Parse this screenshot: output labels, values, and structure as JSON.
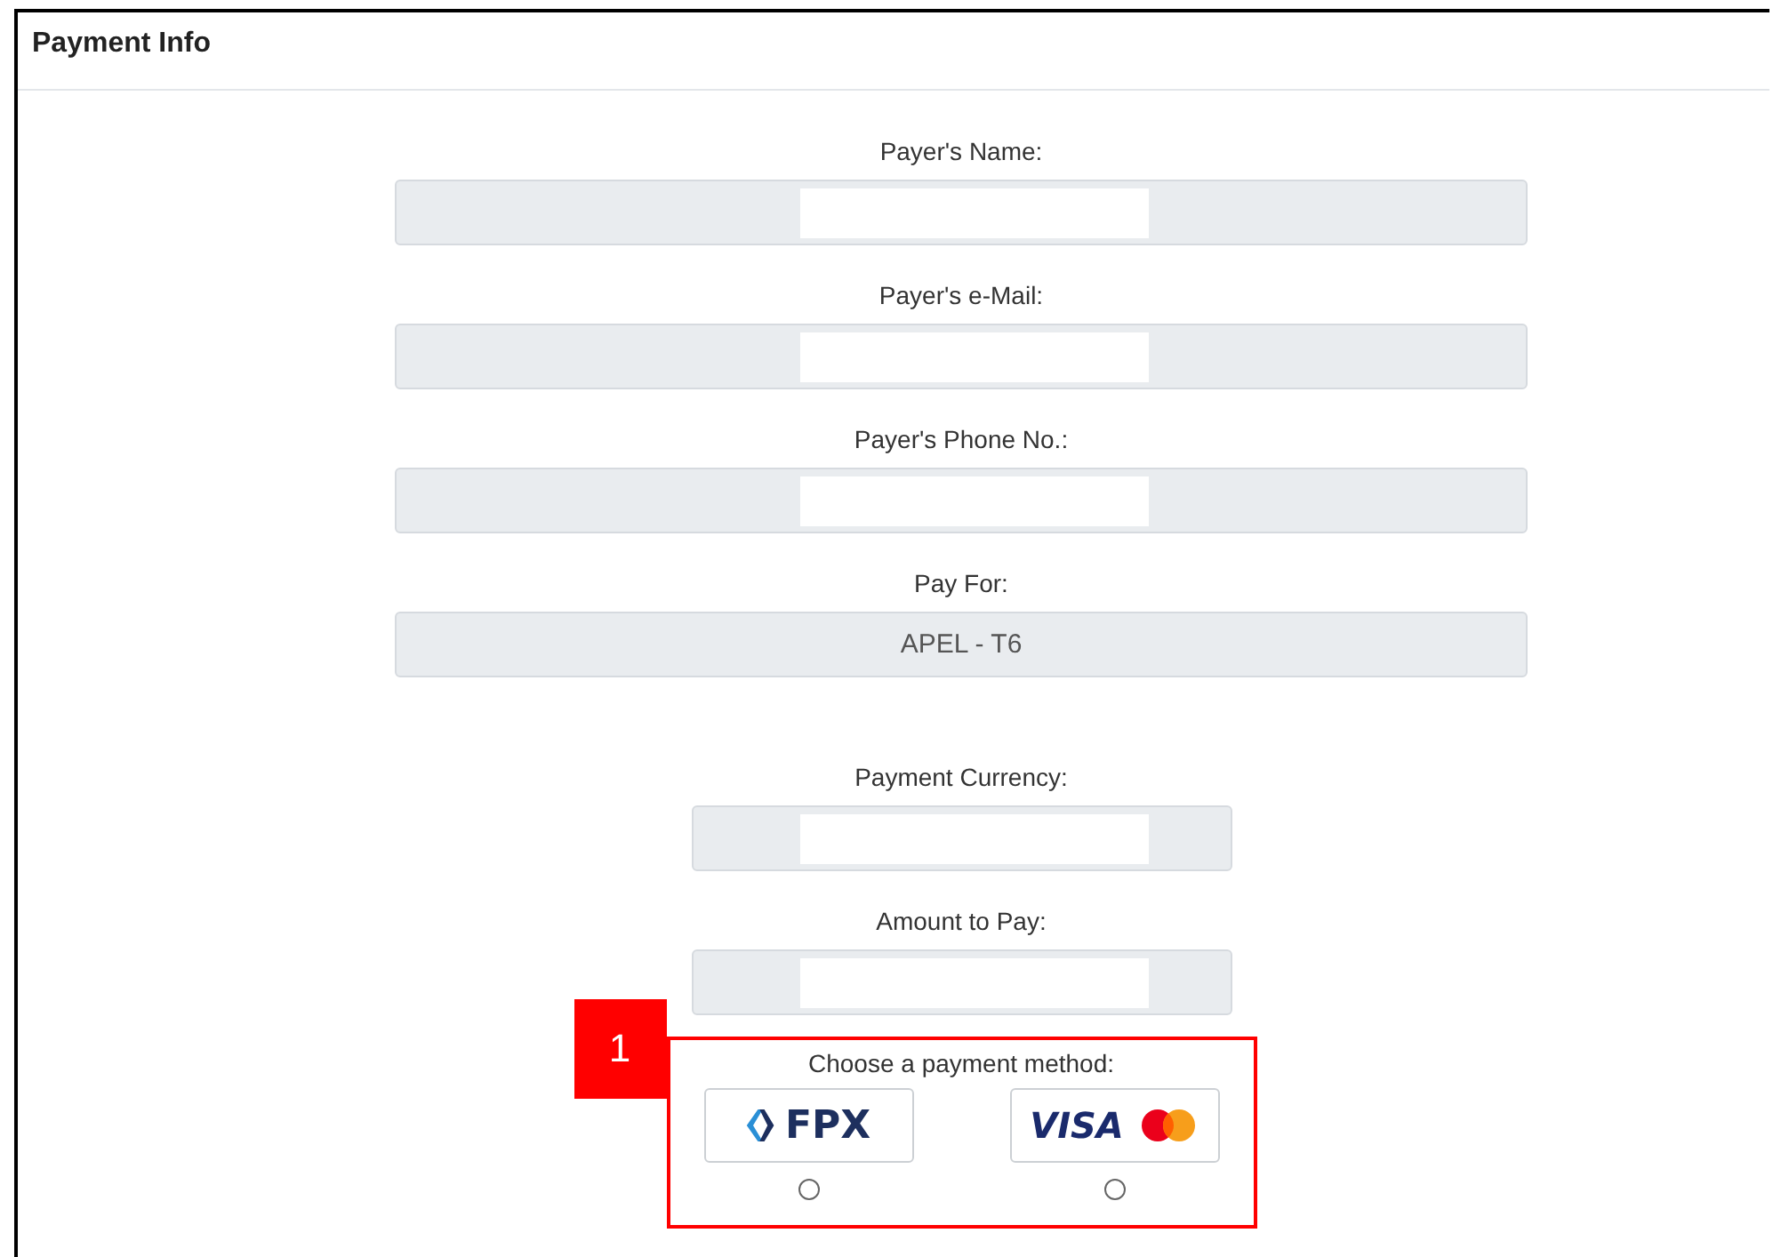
{
  "panel": {
    "title": "Payment Info"
  },
  "payer_fields": [
    {
      "label": "Payer's Name:",
      "kind": "redacted"
    },
    {
      "label": "Payer's e-Mail:",
      "kind": "redacted"
    },
    {
      "label": "Payer's Phone No.:",
      "kind": "redacted"
    },
    {
      "label": "Pay For:",
      "kind": "value",
      "value": "APEL - T6"
    }
  ],
  "payment_fields": [
    {
      "label": "Payment Currency:",
      "kind": "redacted"
    },
    {
      "label": "Amount to Pay:",
      "kind": "redacted"
    }
  ],
  "payment_method": {
    "label": "Choose a payment method:",
    "options": [
      {
        "kind": "fpx",
        "text": "FPX",
        "selected": false
      },
      {
        "kind": "card",
        "text": "VISA",
        "selected": false
      }
    ]
  },
  "callout": {
    "number": "1"
  }
}
